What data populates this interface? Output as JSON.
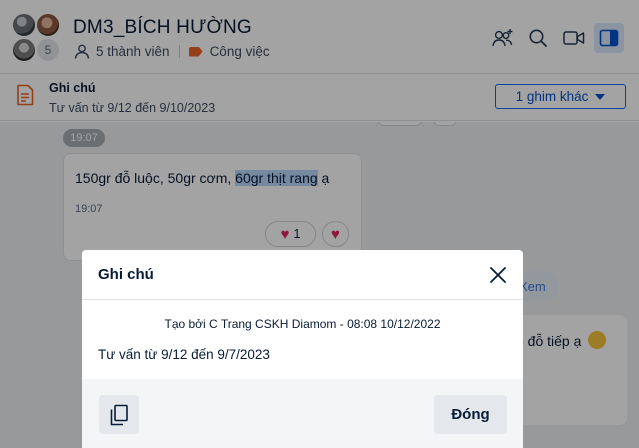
{
  "header": {
    "title": "DM3_BÍCH HƯỜNG",
    "avatar_overflow_count": "5",
    "members_label": "5 thành viên",
    "tag_label": "Công việc",
    "tag_color": "#e8622a",
    "actions": [
      "add-member-icon",
      "search-icon",
      "video-call-icon",
      "sidebar-toggle-icon"
    ]
  },
  "pinned": {
    "title": "Ghi chú",
    "text": "Tư vấn từ 9/12 đến 9/10/2023",
    "more_button": "1 ghim khác"
  },
  "chat": {
    "time_divider": "19:07",
    "message": {
      "text_before": "150gr đỗ luộc, 50gr cơm, ",
      "text_highlight": "60gr thịt rang",
      "text_after": " ạ",
      "time": "19:07",
      "reaction_heart_count": "1"
    },
    "link_label": "Xem",
    "right_message_fragment": "o đỗ tiếp ạ"
  },
  "modal": {
    "title": "Ghi chú",
    "created_by": "Tạo bởi C Trang CSKH Diamom - 08:08 10/12/2022",
    "content": "Tư vấn từ 9/12 đến 9/7/2023",
    "close_button": "Đóng"
  },
  "colors": {
    "accent": "#0068ff",
    "highlight": "#b8d6fb",
    "heart": "#e0245e"
  }
}
